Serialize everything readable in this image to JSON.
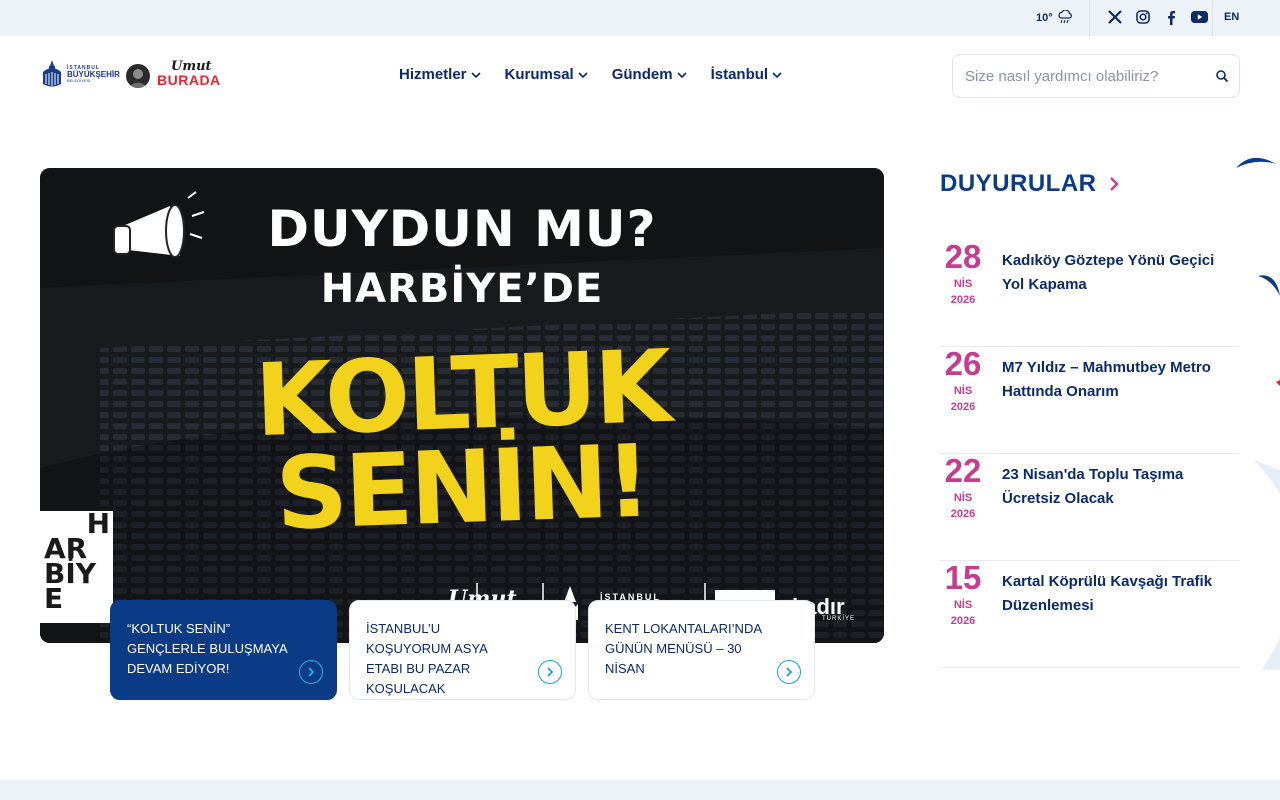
{
  "topbar": {
    "temperature": "10°",
    "weather_icon": "rain-cloud-icon",
    "socials": [
      "x-icon",
      "instagram-icon",
      "facebook-icon",
      "youtube-icon"
    ],
    "language": "EN"
  },
  "header": {
    "logo_lines": [
      "İSTANBUL",
      "BÜYÜKŞEHİR",
      "BELEDİYESİ"
    ],
    "umut_top": "Umut",
    "umut_bottom": "BURADA",
    "nav": [
      {
        "label": "Hizmetler"
      },
      {
        "label": "Kurumsal"
      },
      {
        "label": "Gündem"
      },
      {
        "label": "İstanbul"
      }
    ],
    "search_placeholder": "Size nasıl yardımcı olabiliriz?"
  },
  "hero": {
    "line1": "DUYDUN MU?",
    "line2": "HARBİYE’DE",
    "line3": "KOLTUK",
    "line4": "SENİN!",
    "badge_letters": [
      "H",
      "AR",
      "BİY",
      "E"
    ],
    "footer_umut": "Umut",
    "footer_istanbul": "İSTANBUL",
    "footer_kadir": "kadır",
    "footer_turkiye": "TÜRKİYE"
  },
  "cards": [
    {
      "title": "“KOLTUK SENİN” GENÇLERLE BULUŞMAYA DEVAM EDİYOR!",
      "active": true
    },
    {
      "title": "İSTANBUL’U KOŞUYORUM ASYA ETABI BU PAZAR KOŞULACAK",
      "active": false
    },
    {
      "title": "KENT LOKANTALARI’NDA GÜNÜN MENÜSÜ – 30 NİSAN",
      "active": false
    }
  ],
  "announcements": {
    "title": "DUYURULAR",
    "items": [
      {
        "day": "28",
        "month": "NİS",
        "year": "2026",
        "title": "Kadıköy Göztepe Yönü Geçici Yol Kapama"
      },
      {
        "day": "26",
        "month": "NİS",
        "year": "2026",
        "title": "M7 Yıldız – Mahmutbey Metro Hattında Onarım"
      },
      {
        "day": "22",
        "month": "NİS",
        "year": "2026",
        "title": "23 Nisan'da Toplu Taşıma Ücretsiz Olacak"
      },
      {
        "day": "15",
        "month": "NİS",
        "year": "2026",
        "title": "Kartal Köprülü Kavşağı Trafik Düzenlemesi"
      }
    ]
  },
  "colors": {
    "navy": "#0b2a6b",
    "active_card": "#0b3a86",
    "date_magenta": "#c43d8e",
    "headline_yellow": "#f2d21b",
    "accent_red": "#e3262f",
    "arrow_cyan": "#1aa3c9"
  }
}
